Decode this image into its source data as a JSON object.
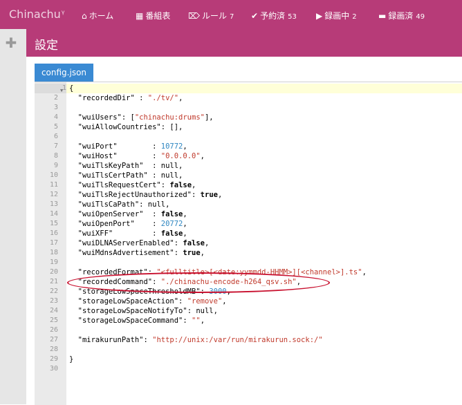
{
  "app": {
    "brand": "Chinachu",
    "brand_super": "γ"
  },
  "nav": [
    {
      "icon": "home-icon",
      "glyph": "⌂",
      "label": "ホーム",
      "count": ""
    },
    {
      "icon": "calendar-icon",
      "glyph": "▦",
      "label": "番組表",
      "count": ""
    },
    {
      "icon": "tags-icon",
      "glyph": "⌦",
      "label": "ルール",
      "count": "7"
    },
    {
      "icon": "check-icon",
      "glyph": "✔",
      "label": "予約済",
      "count": "53"
    },
    {
      "icon": "video-camera-icon",
      "glyph": "▶",
      "label": "録画中",
      "count": "2"
    },
    {
      "icon": "hdd-icon",
      "glyph": "▬",
      "label": "録画済",
      "count": "49"
    }
  ],
  "page": {
    "title": "設定"
  },
  "editor": {
    "tab_label": "config.json",
    "active_line": 1,
    "lines": [
      [
        {
          "t": "{",
          "c": "p"
        }
      ],
      [
        {
          "t": "  \"recordedDir\"",
          "c": "k"
        },
        {
          "t": " : ",
          "c": "p"
        },
        {
          "t": "\"./tv/\"",
          "c": "s"
        },
        {
          "t": ",",
          "c": "p"
        }
      ],
      [],
      [
        {
          "t": "  \"wuiUsers\"",
          "c": "k"
        },
        {
          "t": ": [",
          "c": "p"
        },
        {
          "t": "\"chinachu:drums\"",
          "c": "s"
        },
        {
          "t": "],",
          "c": "p"
        }
      ],
      [
        {
          "t": "  \"wuiAllowCountries\"",
          "c": "k"
        },
        {
          "t": ": [],",
          "c": "p"
        }
      ],
      [],
      [
        {
          "t": "  \"wuiPort\"",
          "c": "k"
        },
        {
          "t": "        : ",
          "c": "p"
        },
        {
          "t": "10772",
          "c": "n"
        },
        {
          "t": ",",
          "c": "p"
        }
      ],
      [
        {
          "t": "  \"wuiHost\"",
          "c": "k"
        },
        {
          "t": "        : ",
          "c": "p"
        },
        {
          "t": "\"0.0.0.0\"",
          "c": "s"
        },
        {
          "t": ",",
          "c": "p"
        }
      ],
      [
        {
          "t": "  \"wuiTlsKeyPath\"",
          "c": "k"
        },
        {
          "t": "  : null,",
          "c": "p"
        }
      ],
      [
        {
          "t": "  \"wuiTlsCertPath\"",
          "c": "k"
        },
        {
          "t": " : null,",
          "c": "p"
        }
      ],
      [
        {
          "t": "  \"wuiTlsRequestCert\"",
          "c": "k"
        },
        {
          "t": ": ",
          "c": "p"
        },
        {
          "t": "false",
          "c": "b"
        },
        {
          "t": ",",
          "c": "p"
        }
      ],
      [
        {
          "t": "  \"wuiTlsRejectUnauthorized\"",
          "c": "k"
        },
        {
          "t": ": ",
          "c": "p"
        },
        {
          "t": "true",
          "c": "b"
        },
        {
          "t": ",",
          "c": "p"
        }
      ],
      [
        {
          "t": "  \"wuiTlsCaPath\"",
          "c": "k"
        },
        {
          "t": ": null,",
          "c": "p"
        }
      ],
      [
        {
          "t": "  \"wuiOpenServer\"",
          "c": "k"
        },
        {
          "t": "  : ",
          "c": "p"
        },
        {
          "t": "false",
          "c": "b"
        },
        {
          "t": ",",
          "c": "p"
        }
      ],
      [
        {
          "t": "  \"wuiOpenPort\"",
          "c": "k"
        },
        {
          "t": "    : ",
          "c": "p"
        },
        {
          "t": "20772",
          "c": "n"
        },
        {
          "t": ",",
          "c": "p"
        }
      ],
      [
        {
          "t": "  \"wuiXFF\"",
          "c": "k"
        },
        {
          "t": "         : ",
          "c": "p"
        },
        {
          "t": "false",
          "c": "b"
        },
        {
          "t": ",",
          "c": "p"
        }
      ],
      [
        {
          "t": "  \"wuiDLNAServerEnabled\"",
          "c": "k"
        },
        {
          "t": ": ",
          "c": "p"
        },
        {
          "t": "false",
          "c": "b"
        },
        {
          "t": ",",
          "c": "p"
        }
      ],
      [
        {
          "t": "  \"wuiMdnsAdvertisement\"",
          "c": "k"
        },
        {
          "t": ": ",
          "c": "p"
        },
        {
          "t": "true",
          "c": "b"
        },
        {
          "t": ",",
          "c": "p"
        }
      ],
      [],
      [
        {
          "t": "  \"recordedFormat\"",
          "c": "k"
        },
        {
          "t": ": ",
          "c": "p"
        },
        {
          "t": "\"<fulltitle>[<date:yymmdd-HHMM>][<channel>].ts\"",
          "c": "s"
        },
        {
          "t": ",",
          "c": "p"
        }
      ],
      [
        {
          "t": "  \"recordedCommand\"",
          "c": "k"
        },
        {
          "t": ": ",
          "c": "p"
        },
        {
          "t": "\"./chinachu-encode-h264_qsv.sh\"",
          "c": "s"
        },
        {
          "t": ",",
          "c": "p"
        }
      ],
      [
        {
          "t": "  \"storageLowSpaceThresholdMB\"",
          "c": "k"
        },
        {
          "t": ": ",
          "c": "p"
        },
        {
          "t": "3000",
          "c": "n"
        },
        {
          "t": ",",
          "c": "p"
        }
      ],
      [
        {
          "t": "  \"storageLowSpaceAction\"",
          "c": "k"
        },
        {
          "t": ": ",
          "c": "p"
        },
        {
          "t": "\"remove\"",
          "c": "s"
        },
        {
          "t": ",",
          "c": "p"
        }
      ],
      [
        {
          "t": "  \"storageLowSpaceNotifyTo\"",
          "c": "k"
        },
        {
          "t": ": null,",
          "c": "p"
        }
      ],
      [
        {
          "t": "  \"storageLowSpaceCommand\"",
          "c": "k"
        },
        {
          "t": ": ",
          "c": "p"
        },
        {
          "t": "\"\"",
          "c": "s"
        },
        {
          "t": ",",
          "c": "p"
        }
      ],
      [],
      [
        {
          "t": "  \"mirakurunPath\"",
          "c": "k"
        },
        {
          "t": ": ",
          "c": "p"
        },
        {
          "t": "\"http://unix:/var/run/mirakurun.sock:/\"",
          "c": "s"
        }
      ],
      [],
      [
        {
          "t": "}",
          "c": "p"
        }
      ],
      []
    ]
  },
  "colors": {
    "header_bg": "#b73b78",
    "tab_bg": "#3a8ad3",
    "annotation": "#c8102e"
  }
}
